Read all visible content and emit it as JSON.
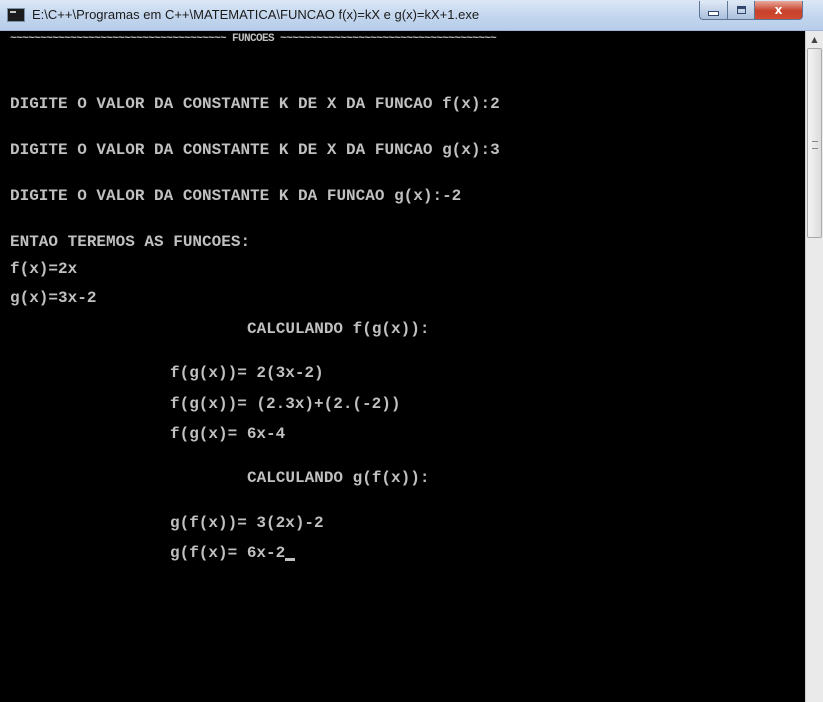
{
  "window": {
    "title": "E:\\C++\\Programas em C++\\MATEMATICA\\FUNCAO f(x)=kX e g(x)=kX+1.exe",
    "minimize_glyph": "",
    "maximize_glyph": "",
    "close_glyph": "x"
  },
  "console": {
    "header": "~~~~~~~~~~~~~~~~~~~~~~~~~~~~~~~~~~~~ FUNCOES ~~~~~~~~~~~~~~~~~~~~~~~~~~~~~~~~~~~~",
    "prompt_f": "DIGITE O VALOR DA CONSTANTE K DE X DA FUNCAO f(x):2",
    "prompt_g": "DIGITE O VALOR DA CONSTANTE K DE X DA FUNCAO g(x):3",
    "prompt_gk": "DIGITE O VALOR DA CONSTANTE K DA FUNCAO g(x):-2",
    "then_label": "ENTAO TEREMOS AS FUNCOES:",
    "f_def": "f(x)=2x",
    "g_def": "g(x)=3x-2",
    "calc_fg_title": "CALCULANDO f(g(x)):",
    "fg_step1": "f(g(x))= 2(3x-2)",
    "fg_step2": "f(g(x))= (2.3x)+(2.(-2))",
    "fg_result": "f(g(x)= 6x-4",
    "calc_gf_title": "CALCULANDO g(f(x)):",
    "gf_step1": "g(f(x))= 3(2x)-2",
    "gf_result": "g(f(x)= 6x-2"
  },
  "icons": {
    "app": "console-app-icon",
    "scroll_up": "scroll-up-arrow-icon"
  },
  "colors": {
    "console_bg": "#000000",
    "console_text": "#c0c0c0",
    "close_button": "#c7402a"
  }
}
